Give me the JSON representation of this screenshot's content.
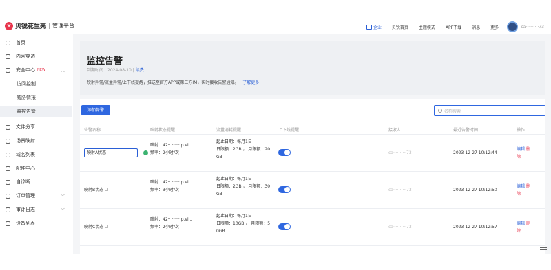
{
  "header": {
    "logo_mark": "Y",
    "brand": "贝锐花生壳",
    "sub": "管理平台",
    "nav": [
      "企业",
      "贝锐首页",
      "主题模式",
      "APP下载",
      "消息",
      "更多"
    ],
    "username": "ca··········73"
  },
  "sidebar": {
    "items": [
      {
        "label": "首页"
      },
      {
        "label": "内网穿透"
      },
      {
        "label": "安全中心",
        "badge": "NEW"
      },
      {
        "label": "访问控制"
      },
      {
        "label": "威胁情报"
      },
      {
        "label": "监控告警"
      },
      {
        "label": "文件分享"
      },
      {
        "label": "场景映射"
      },
      {
        "label": "域名列表"
      },
      {
        "label": "配件中心"
      },
      {
        "label": "自诊断"
      },
      {
        "label": "订单管理"
      },
      {
        "label": "审计日志"
      },
      {
        "label": "设备列表"
      }
    ]
  },
  "page": {
    "title": "监控告警",
    "expire_label": "到期时间：2024-08-10",
    "renew": "续费",
    "description": "映射异常/流量异常/上下线提醒，推送至官方APP或第三方IM，实时接收告警通知。",
    "more": "了解更多"
  },
  "toolbar": {
    "add_label": "添加告警",
    "search_placeholder": "名称搜索"
  },
  "table": {
    "headers": [
      "告警名称",
      "映射状态提醒",
      "流量消耗提醒",
      "上下线提醒",
      "接收人",
      "最近告警时间",
      "操作"
    ],
    "rows": [
      {
        "name": "映射A状态",
        "map_line1": "映射：42··········p.vi...",
        "map_line2": "频率：2小时/次",
        "traffic_line1": "起止日期：每月1日",
        "traffic_line2": "日限额：2GB ， 月限额：20",
        "traffic_line3": "GB",
        "receiver": "ca··········73",
        "time": "2023-12-27 10:12:44",
        "edit": "编辑",
        "delete_1": "删",
        "delete_2": "除"
      },
      {
        "name": "映射B状态",
        "map_line1": "映射：42··········p.vi...",
        "map_line2": "频率：3小时/次",
        "traffic_line1": "起止日期：每月1日",
        "traffic_line2": "日限额：2GB ， 月限额：30",
        "traffic_line3": "GB",
        "receiver": "ca··········73",
        "time": "2023-12-27 10:12:50",
        "edit": "编辑",
        "delete_1": "删",
        "delete_2": "除"
      },
      {
        "name": "映射C状态",
        "map_line1": "映射：42··········p.vi...",
        "map_line2": "频率：2小时/次",
        "traffic_line1": "起止日期：每月1日",
        "traffic_line2": "日限额：10GB ， 月限额：5",
        "traffic_line3": "0GB",
        "receiver": "ca··········73",
        "time": "2023-12-27 10:12:57",
        "edit": "编辑",
        "delete_1": "删",
        "delete_2": "除"
      }
    ]
  },
  "colors": {
    "accent": "#2f67e0",
    "brand": "#e8364d",
    "success": "#3cb371"
  }
}
